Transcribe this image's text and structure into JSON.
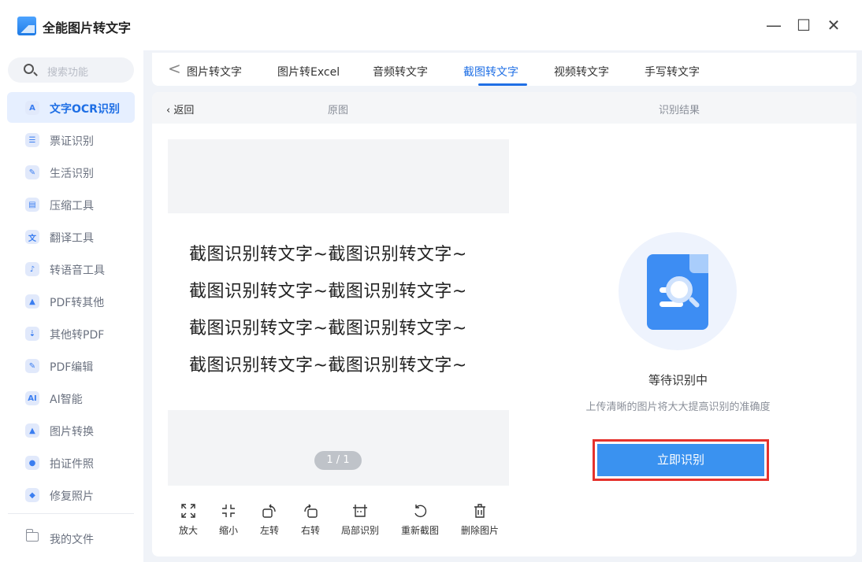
{
  "app": {
    "title": "全能图片转文字"
  },
  "window": {
    "minimize": "—",
    "maximize": "☐",
    "close": "✕"
  },
  "sidebar": {
    "search_placeholder": "搜索功能",
    "items": [
      {
        "label": "文字OCR识别",
        "icon": "A",
        "active": true
      },
      {
        "label": "票证识别",
        "icon": "☰"
      },
      {
        "label": "生活识别",
        "icon": "✎"
      },
      {
        "label": "压缩工具",
        "icon": "▤"
      },
      {
        "label": "翻译工具",
        "icon": "文"
      },
      {
        "label": "转语音工具",
        "icon": "♪"
      },
      {
        "label": "PDF转其他",
        "icon": "▲"
      },
      {
        "label": "其他转PDF",
        "icon": "⇣"
      },
      {
        "label": "PDF编辑",
        "icon": "✎"
      },
      {
        "label": "AI智能",
        "icon": "AI"
      },
      {
        "label": "图片转换",
        "icon": "▲"
      },
      {
        "label": "拍证件照",
        "icon": "●"
      },
      {
        "label": "修复照片",
        "icon": "◆"
      }
    ],
    "my_files": "我的文件"
  },
  "tabs": {
    "back": "<",
    "items": [
      "图片转文字",
      "图片转Excel",
      "音频转文字",
      "截图转文字",
      "视频转文字",
      "手写转文字"
    ],
    "active": 3
  },
  "content": {
    "back_label": "返回",
    "original_label": "原图",
    "result_label": "识别结果",
    "preview_lines": [
      "截图识别转文字~截图识别转文字~",
      "截图识别转文字~截图识别转文字~",
      "截图识别转文字~截图识别转文字~",
      "截图识别转文字~截图识别转文字~"
    ],
    "page_indicator": "1 / 1"
  },
  "toolbar": {
    "zoom_in": "放大",
    "zoom_out": "缩小",
    "rotate_left": "左转",
    "rotate_right": "右转",
    "partial_recognize": "局部识别",
    "recapture": "重新截图",
    "delete_image": "删除图片"
  },
  "result": {
    "status_title": "等待识别中",
    "status_sub": "上传清晰的图片将大大提高识别的准确度",
    "recognize_button": "立即识别"
  },
  "colors": {
    "accent": "#1f6fe5",
    "button": "#3a92f0",
    "highlight": "#e5322d"
  }
}
